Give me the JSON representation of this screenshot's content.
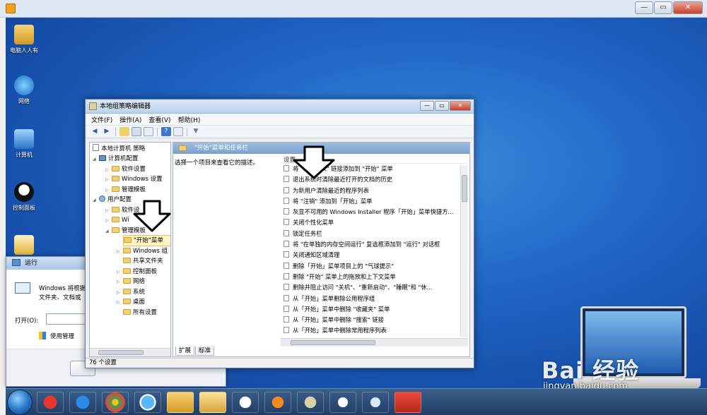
{
  "desktop": {
    "icons": [
      {
        "label": "电脑人人有"
      },
      {
        "label": "网络"
      },
      {
        "label": "计算机"
      },
      {
        "label": "控制面板"
      }
    ]
  },
  "run_dialog": {
    "title": "运行",
    "description": "Windows 将根据",
    "description2": "文件夹、文档或",
    "open_label": "打开(O):",
    "admin_note": "使用管理"
  },
  "window": {
    "title": "本地组策略编辑器",
    "menu": [
      "文件(F)",
      "操作(A)",
      "查看(V)",
      "帮助(H)"
    ],
    "status": "76 个设置"
  },
  "tree": [
    {
      "label": "本地计算机 策略"
    },
    {
      "label": "计算机配置"
    },
    {
      "label": "软件设置"
    },
    {
      "label": "Windows 设置"
    },
    {
      "label": "管理模板"
    },
    {
      "label": "用户配置"
    },
    {
      "label": "软件设"
    },
    {
      "label": "Wi"
    },
    {
      "label": "管理模板"
    },
    {
      "label": "\"开始\"菜单"
    },
    {
      "label": "Windows 组"
    },
    {
      "label": "共享文件夹"
    },
    {
      "label": "控制面板"
    },
    {
      "label": "网络"
    },
    {
      "label": "系统"
    },
    {
      "label": "桌面"
    },
    {
      "label": "所有设置"
    }
  ],
  "right_pane": {
    "header": "\"开始\"菜单和任务栏",
    "description": "选择一个项目来查看它的描述。",
    "column": "设置",
    "items": [
      "将 \"Internet\" 链接添加到 \"开始\" 菜单",
      "退出系统时清除最近打开的文档的历史",
      "为新用户清除最近的程序列表",
      "将 \"注销\" 添加到「开始」菜单",
      "灰显不可用的 Windows Installer 程序「开始」菜单快捷方...",
      "关闭个性化菜单",
      "锁定任务栏",
      "将 \"在单独的内存空间运行\" 复选框添加到 \"运行\" 对话框",
      "关闭通知区域清理",
      "删除「开始」菜单项目上的 \"气球提示\"",
      "删除 \"开始\" 菜单上的拖放和上下文菜单",
      "删除并阻止访问 \"关机\"、\"重新启动\"、\"睡眠\"和 \"休...",
      "从「开始」菜单删除公用程序组",
      "从「开始」菜单中删除 \"收藏夹\" 菜单",
      "从「开始」菜单中删除 \"搜索\" 链接",
      "从「开始」菜单中删除常用程序列表"
    ],
    "tabs": [
      "扩展",
      "标准"
    ]
  },
  "watermark": {
    "brand": "Bai 经验",
    "url": "jingyan.baidu.com"
  },
  "colors": {
    "desktop_blue": "#1e62c2",
    "header_blue": "#7c9fcc"
  }
}
